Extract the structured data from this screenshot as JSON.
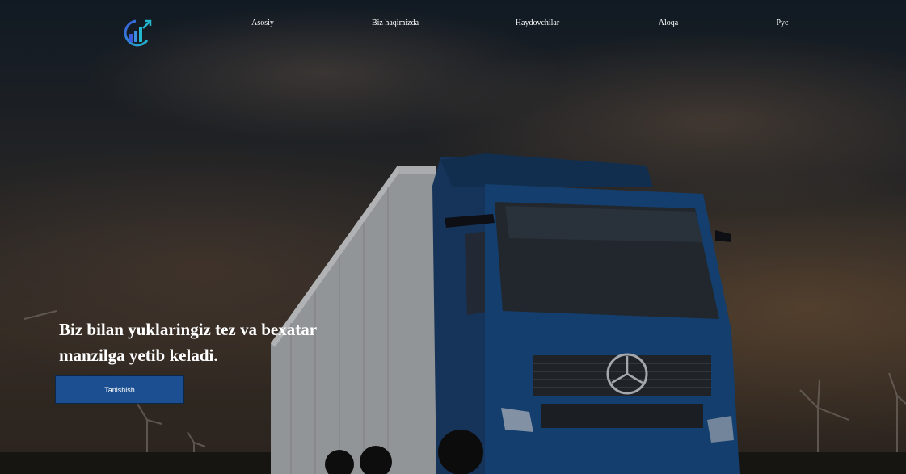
{
  "header": {
    "logo_icon": "chart-arrow-logo-icon",
    "nav": [
      {
        "label": "Asosiy"
      },
      {
        "label": "Biz haqimizda"
      },
      {
        "label": "Haydovchilar"
      },
      {
        "label": "Aloqa"
      },
      {
        "label": "Рус"
      }
    ]
  },
  "hero": {
    "headline": "Biz bilan yuklaringiz tez va bexatar manzilga yetib keladi.",
    "cta_label": "Tanishish",
    "background_image": "blue-truck-at-dusk-with-wind-turbines",
    "cta_color": "#1b4f91"
  }
}
